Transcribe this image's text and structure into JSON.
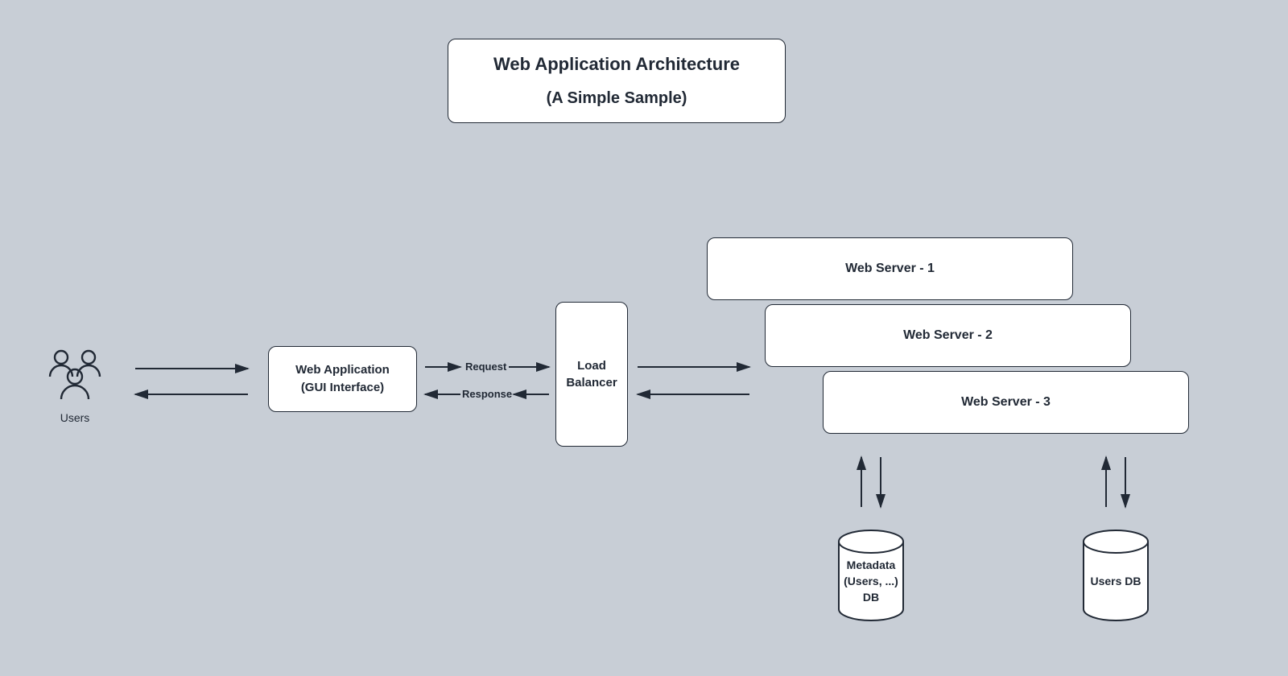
{
  "title": {
    "main": "Web Application Architecture",
    "sub": "(A Simple Sample)"
  },
  "nodes": {
    "users_label": "Users",
    "webapp_line1": "Web Application",
    "webapp_line2": "(GUI Interface)",
    "load_balancer_line1": "Load",
    "load_balancer_line2": "Balancer",
    "web_server_1": "Web Server - 1",
    "web_server_2": "Web Server - 2",
    "web_server_3": "Web Server - 3",
    "db_metadata_line1": "Metadata",
    "db_metadata_line2": "(Users, ...)",
    "db_metadata_line3": "DB",
    "db_users": "Users DB"
  },
  "edges": {
    "request": "Request",
    "response": "Response"
  }
}
